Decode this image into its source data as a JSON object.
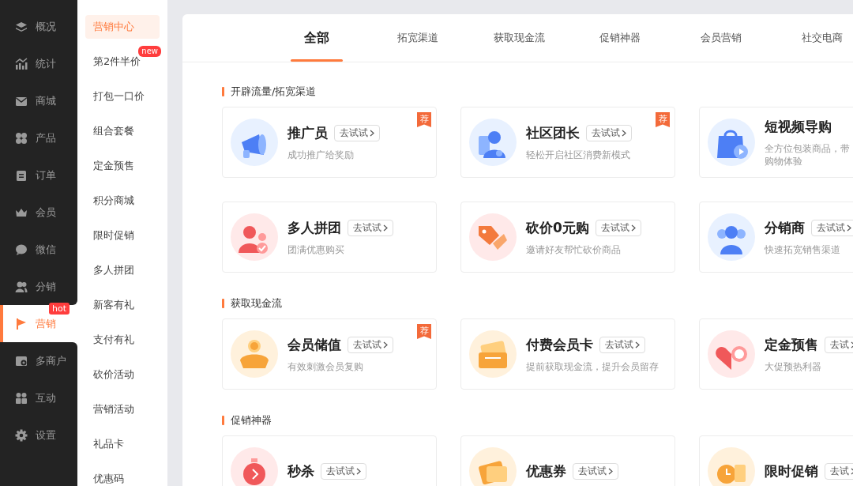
{
  "sidebar": {
    "items": [
      {
        "label": "概况",
        "kind": "layers",
        "selected": false
      },
      {
        "label": "统计",
        "kind": "chart",
        "selected": false
      },
      {
        "label": "商城",
        "kind": "envelope",
        "selected": false
      },
      {
        "label": "产品",
        "kind": "grid",
        "selected": false
      },
      {
        "label": "订单",
        "kind": "clipboard",
        "selected": false
      },
      {
        "label": "会员",
        "kind": "crown",
        "selected": false
      },
      {
        "label": "微信",
        "kind": "chat",
        "selected": false
      },
      {
        "label": "分销",
        "kind": "people",
        "selected": false
      },
      {
        "label": "营销",
        "kind": "flag",
        "selected": true,
        "badge": "hot"
      },
      {
        "label": "多商户",
        "kind": "store",
        "selected": false
      },
      {
        "label": "互动",
        "kind": "pair",
        "selected": false
      },
      {
        "label": "设置",
        "kind": "gear",
        "selected": false
      }
    ]
  },
  "submenu": {
    "items": [
      {
        "label": "营销中心",
        "selected": true
      },
      {
        "label": "第2件半价",
        "selected": false,
        "badge": "new"
      },
      {
        "label": "打包一口价",
        "selected": false
      },
      {
        "label": "组合套餐",
        "selected": false
      },
      {
        "label": "定金预售",
        "selected": false
      },
      {
        "label": "积分商城",
        "selected": false
      },
      {
        "label": "限时促销",
        "selected": false
      },
      {
        "label": "多人拼团",
        "selected": false
      },
      {
        "label": "新客有礼",
        "selected": false
      },
      {
        "label": "支付有礼",
        "selected": false
      },
      {
        "label": "砍价活动",
        "selected": false
      },
      {
        "label": "营销活动",
        "selected": false
      },
      {
        "label": "礼品卡",
        "selected": false
      },
      {
        "label": "优惠码",
        "selected": false
      }
    ]
  },
  "tabs": [
    {
      "label": "全部",
      "selected": true
    },
    {
      "label": "拓宽渠道",
      "selected": false
    },
    {
      "label": "获取现金流",
      "selected": false
    },
    {
      "label": "促销神器",
      "selected": false
    },
    {
      "label": "会员营销",
      "selected": false
    },
    {
      "label": "社交电商",
      "selected": false
    }
  ],
  "sections": [
    {
      "title": "开辟流量/拓宽渠道",
      "cards": [
        {
          "kind": "megaphone",
          "title": "推广员",
          "button": "去试试",
          "desc": [
            "成功推广给奖励"
          ],
          "badge": "荐"
        },
        {
          "kind": "leader",
          "title": "社区团长",
          "button": "去试试",
          "desc": [
            "轻松开启社区消费新模式"
          ],
          "badge": "荐"
        },
        {
          "kind": "bag",
          "title": "短视频导购",
          "desc": [
            "全方位包装商品，带",
            "购物体验"
          ]
        },
        {
          "kind": "group",
          "title": "多人拼团",
          "button": "去试试",
          "desc": [
            "团满优惠购买"
          ]
        },
        {
          "kind": "tag",
          "title": "砍价0元购",
          "button": "去试试",
          "desc": [
            "邀请好友帮忙砍价商品"
          ]
        },
        {
          "kind": "distributor",
          "title": "分销商",
          "button": "去试试",
          "desc": [
            "快速拓宽销售渠道"
          ]
        }
      ]
    },
    {
      "title": "获取现金流",
      "cards": [
        {
          "kind": "coin",
          "title": "会员储值",
          "button": "去试试",
          "desc": [
            "有效刺激会员复购"
          ],
          "badge": "荐"
        },
        {
          "kind": "vip",
          "title": "付费会员卡",
          "button": "去试试",
          "desc": [
            "提前获取现金流，提升会员留存"
          ]
        },
        {
          "kind": "piggy",
          "title": "定金预售",
          "button": "去试",
          "desc": [
            "大促预热利器"
          ]
        }
      ]
    },
    {
      "title": "促销神器",
      "cards": [
        {
          "kind": "timer",
          "title": "秒杀",
          "button": "去试试"
        },
        {
          "kind": "coupon",
          "title": "优惠券",
          "button": "去试试"
        },
        {
          "kind": "clock",
          "title": "限时促销",
          "button": "去试"
        }
      ]
    }
  ]
}
